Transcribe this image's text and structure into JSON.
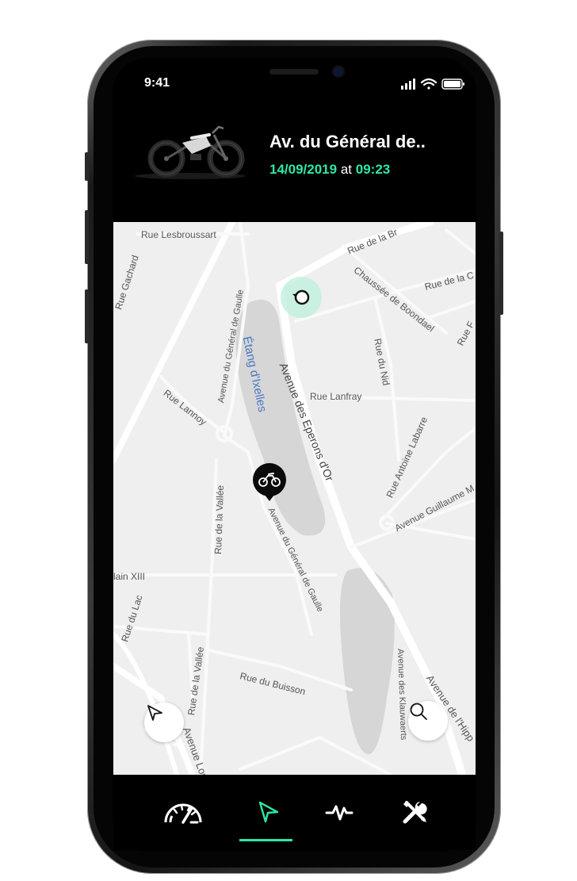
{
  "status_bar": {
    "time": "9:41"
  },
  "trip": {
    "title": "Av. du Général de..",
    "date": "14/09/2019",
    "at_label": "at",
    "time": "09:23"
  },
  "map": {
    "streets": [
      "Rue Lesbroussart",
      "Rue de la Br",
      "Rue Gachard",
      "Chaussée de Boondael",
      "Rue de la C",
      "Avenue du Général de Gaulle",
      "Rue du Nid",
      "Rue F",
      "Avenue des Eperons d'Or",
      "Rue Lanfray",
      "Rue Lannoy",
      "Rue Antoine Labarre",
      "Avenue Guillaume M",
      "Rue de la Vallée",
      "Avenue du Général de Gaulle",
      "lain XIII",
      "Rue du Lac",
      "Rue de la Vallée",
      "Rue du Buisson",
      "Avenue des Klauwaerts",
      "Avenue de l'Hipp",
      "Avenue Lou"
    ],
    "lake_label": "Étang d'Ixelles"
  },
  "colors": {
    "accent": "#2ee8a6",
    "background": "#000000",
    "map_bg": "#efefef",
    "lake": "#d6d6d6"
  },
  "icons": {
    "bike": "motorbike-icon",
    "locate": "navigation-arrow-icon",
    "search": "search-icon",
    "start": "start-pin-icon",
    "end": "bike-location-pin-icon"
  },
  "nav": {
    "items": [
      {
        "icon": "speedometer-icon"
      },
      {
        "icon": "navigation-arrow-icon",
        "active": true
      },
      {
        "icon": "activity-icon"
      },
      {
        "icon": "tools-icon"
      }
    ]
  }
}
